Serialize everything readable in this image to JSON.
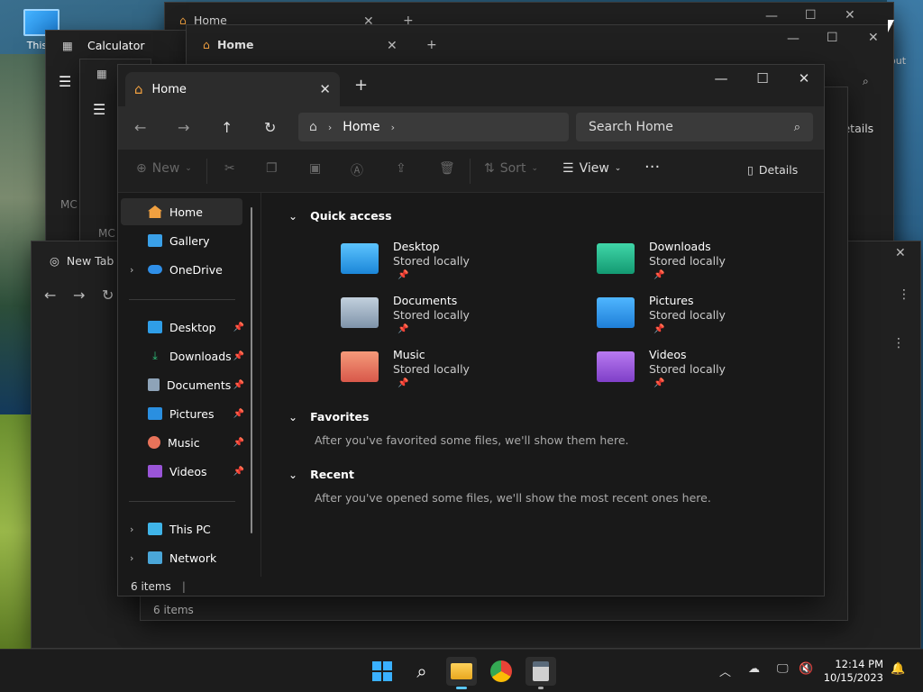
{
  "desktop": {
    "icon_label": "This P"
  },
  "bg_windows": {
    "home_back": {
      "tab": "Home"
    },
    "home_mid": {
      "tab": "Home",
      "details": "Details",
      "status": "6 items"
    },
    "calculator": {
      "title": "Calculator",
      "mem": "MC",
      "mem2": "MC"
    },
    "chrome": {
      "tab": "New Tab"
    },
    "right_edge_text": "out"
  },
  "explorer": {
    "tab_title": "Home",
    "address": {
      "root": "Home"
    },
    "search_placeholder": "Search Home",
    "toolbar": {
      "new": "New",
      "sort": "Sort",
      "view": "View",
      "details": "Details"
    },
    "sidebar": {
      "top": [
        {
          "label": "Home",
          "icon": "home-icon"
        },
        {
          "label": "Gallery",
          "icon": "gallery-icon"
        },
        {
          "label": "OneDrive",
          "icon": "cloud-icon"
        }
      ],
      "pinned": [
        {
          "label": "Desktop",
          "icon": "desktop-folder-icon"
        },
        {
          "label": "Downloads",
          "icon": "download-icon"
        },
        {
          "label": "Documents",
          "icon": "documents-icon"
        },
        {
          "label": "Pictures",
          "icon": "pictures-icon"
        },
        {
          "label": "Music",
          "icon": "music-icon"
        },
        {
          "label": "Videos",
          "icon": "videos-icon"
        }
      ],
      "bottom": [
        {
          "label": "This PC",
          "icon": "computer-icon"
        },
        {
          "label": "Network",
          "icon": "network-icon"
        }
      ]
    },
    "sections": {
      "quick_access": "Quick access",
      "favorites": "Favorites",
      "favorites_hint": "After you've favorited some files, we'll show them here.",
      "recent": "Recent",
      "recent_hint": "After you've opened some files, we'll show the most recent ones here."
    },
    "quick_access": [
      {
        "name": "Desktop",
        "sub": "Stored locally",
        "color": "#2f9ee8"
      },
      {
        "name": "Downloads",
        "sub": "Stored locally",
        "color": "#1fb58a"
      },
      {
        "name": "Documents",
        "sub": "Stored locally",
        "color": "#8ea3b8"
      },
      {
        "name": "Pictures",
        "sub": "Stored locally",
        "color": "#2a8fe0"
      },
      {
        "name": "Music",
        "sub": "Stored locally",
        "color": "#e8735a"
      },
      {
        "name": "Videos",
        "sub": "Stored locally",
        "color": "#9a55d8"
      }
    ],
    "status": "6 items"
  },
  "taskbar": {
    "time": "12:14 PM",
    "date": "10/15/2023"
  }
}
